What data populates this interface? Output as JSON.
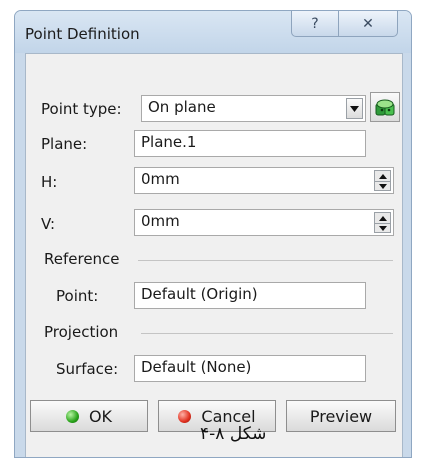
{
  "window": {
    "title": "Point Definition",
    "help_glyph": "?",
    "close_glyph": "✕"
  },
  "form": {
    "point_type_label": "Point type:",
    "point_type_value": "On plane",
    "plane_label": "Plane:",
    "plane_value": "Plane.1",
    "h_label": "H:",
    "h_value": "0mm",
    "v_label": "V:",
    "v_value": "0mm"
  },
  "reference": {
    "section_label": "Reference",
    "point_label": "Point:",
    "point_value": "Default (Origin)"
  },
  "projection": {
    "section_label": "Projection",
    "surface_label": "Surface:",
    "surface_value": "Default (None)"
  },
  "buttons": {
    "ok": "OK",
    "cancel": "Cancel",
    "preview": "Preview"
  },
  "caption": "شکل ۸-۴",
  "icons": {
    "combo": "chevron-down-icon",
    "stacked": "stacked-shapes-icon",
    "spin_up": "spin-up-icon",
    "spin_down": "spin-down-icon",
    "ok": "green-dot-icon",
    "cancel": "red-dot-icon"
  },
  "colors": {
    "titlebar": "#c9d9ea",
    "panel": "#f0f0f0",
    "ok_dot": "#29a31a",
    "cancel_dot": "#e0301f"
  }
}
